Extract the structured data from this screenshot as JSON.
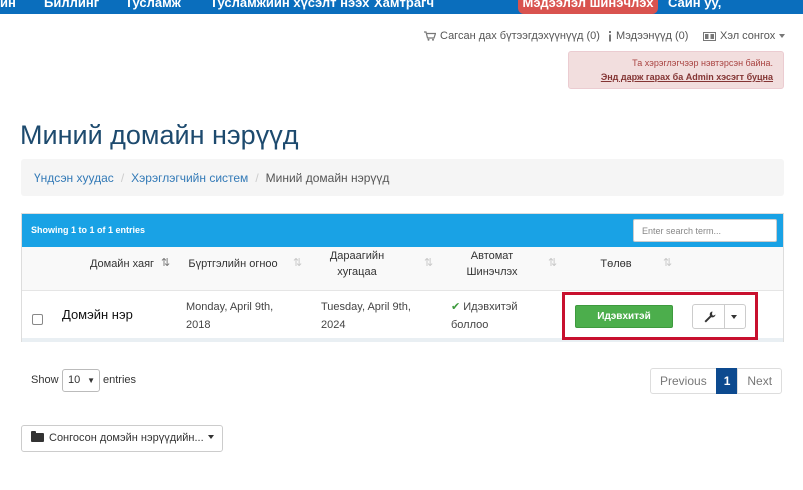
{
  "topnav": {
    "items": [
      "ин",
      "Биллинг",
      "Тусламж",
      "Тусламжийн хүсэлт нээх",
      "Хамтрагч"
    ],
    "update_button": "Мэдээлэл шинэчлэх",
    "greeting": "Сайн уу,"
  },
  "utility": {
    "cart": "Сагсан дах бүтээгдэхүүнүүд (0)",
    "notifications": "Мэдээнүүд (0)",
    "language": "Хэл сонгох"
  },
  "notice": {
    "line1": "Та хэрэглэгчээр нэвтэрсэн байна.",
    "link": "Энд дарж гарах ба Admin хэсэгт буцна"
  },
  "page_title": "Миний домайн нэрүүд",
  "breadcrumb": [
    "Үндсэн хуудас",
    "Хэрэглэгчийн систем",
    "Миний домайн нэрүүд"
  ],
  "table": {
    "showing": "Showing 1 to 1 of 1 entries",
    "search_placeholder": "Enter search term...",
    "columns": [
      "Домайн хаяг",
      "Бүртгэлийн огноо",
      "Дараагийн хугацаа",
      "Автомат Шинэчлэх",
      "Төлөв"
    ],
    "rows": [
      {
        "domain": "Домэйн нэр",
        "registered": "Monday, April 9th, 2018",
        "next_due": "Tuesday, April 9th, 2024",
        "auto_renew": "Идэвхитэй боллоо",
        "status": "Идэвхитэй"
      }
    ]
  },
  "entries": {
    "show": "Show",
    "value": "10",
    "suffix": "entries"
  },
  "pagination": {
    "previous": "Previous",
    "current": "1",
    "next": "Next"
  },
  "bulk_action": "Сонгосон домэйн нэрүүдийн...",
  "colors": {
    "nav": "#0a6ebd",
    "table_header": "#19a2e5",
    "status_active": "#4cae4c",
    "highlight": "#c8102e",
    "title": "#1d4a6e"
  }
}
